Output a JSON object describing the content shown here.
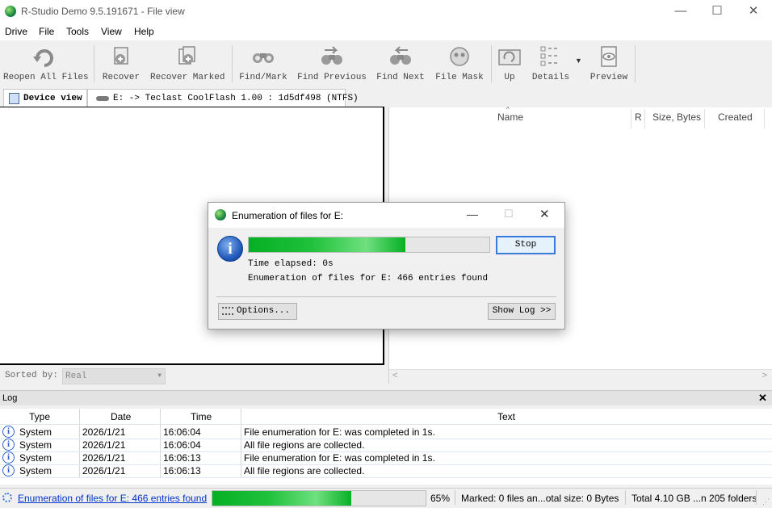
{
  "window": {
    "title": "R-Studio Demo 9.5.191671 - File view",
    "minimize": "—",
    "maximize": "☐",
    "close": "✕"
  },
  "menu": [
    "Drive",
    "File",
    "Tools",
    "View",
    "Help"
  ],
  "toolbar": {
    "buttons": [
      {
        "label": "Reopen All Files",
        "icon": "reopen-icon"
      },
      {
        "label": "Recover",
        "icon": "recover-icon"
      },
      {
        "label": "Recover Marked",
        "icon": "recover-marked-icon"
      },
      {
        "label": "Find/Mark",
        "icon": "binoculars-icon"
      },
      {
        "label": "Find Previous",
        "icon": "find-previous-icon"
      },
      {
        "label": "Find Next",
        "icon": "find-next-icon"
      },
      {
        "label": "File Mask",
        "icon": "file-mask-icon"
      },
      {
        "label": "Up",
        "icon": "up-folder-icon"
      },
      {
        "label": "Details",
        "icon": "details-view-icon"
      },
      {
        "label": "Preview",
        "icon": "preview-eye-icon"
      }
    ]
  },
  "tabs": [
    {
      "label": "Device view"
    },
    {
      "label": "E: -> Teclast CoolFlash 1.00 : 1d5df498 (NTFS)"
    }
  ],
  "file_columns": [
    "Name",
    "R",
    "Size, Bytes",
    "Created"
  ],
  "sort": {
    "label": "Sorted by:",
    "value": "Real"
  },
  "log": {
    "title": "Log",
    "close": "✕",
    "columns": [
      "Type",
      "Date",
      "Time",
      "Text"
    ],
    "rows": [
      {
        "type": "System",
        "date": "2026/1/21",
        "time": "16:06:04",
        "text": "File enumeration for E: was completed in 1s."
      },
      {
        "type": "System",
        "date": "2026/1/21",
        "time": "16:06:04",
        "text": "All file regions are collected."
      },
      {
        "type": "System",
        "date": "2026/1/21",
        "time": "16:06:13",
        "text": "File enumeration for E: was completed in 1s."
      },
      {
        "type": "System",
        "date": "2026/1/21",
        "time": "16:06:13",
        "text": "All file regions are collected."
      }
    ]
  },
  "status": {
    "link": "Enumeration of files for E: 466 entries found",
    "progress_percent": 65,
    "progress_text": "65%",
    "marked": "Marked: 0 files an...otal size: 0 Bytes",
    "total": "Total 4.10 GB ...n 205 folders"
  },
  "dialog": {
    "title": "Enumeration of files for E:",
    "stop": "Stop",
    "progress_fraction": 0.65,
    "time_elapsed": "Time elapsed: 0s",
    "enumeration": "Enumeration of files for E: 466 entries found",
    "options": "Options...",
    "show_log": "Show Log >>"
  },
  "colors": {
    "progress": "#06b025",
    "link": "#0033cc",
    "info": "#2d63c8"
  }
}
